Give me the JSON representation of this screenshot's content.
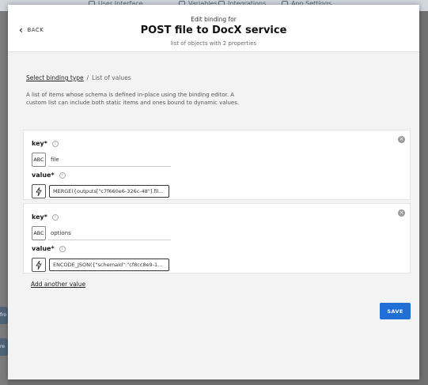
{
  "background": {
    "tabs": [
      {
        "label": "User Interface"
      },
      {
        "label": "Variables"
      },
      {
        "label": "Integrations"
      },
      {
        "label": "App Settings"
      }
    ],
    "left_chips": [
      "fro",
      "re"
    ]
  },
  "header": {
    "back_label": "BACK",
    "pretitle": "Edit binding for",
    "title": "POST file to DocX service",
    "subtitle": "list of objects with 2 properties"
  },
  "breadcrumb": {
    "link": "Select binding type",
    "separator": "/",
    "current": "List of values"
  },
  "description": "A list of items whose schema is defined in-place using the binding editor. A custom list can include both static items and ones bound to dynamic values.",
  "items": [
    {
      "key_label": "key*",
      "key_type": "ABC",
      "key_value": "file",
      "value_label": "value*",
      "value_expression": "MERGE({outputs[\"c7f660e6-326c-48\"].files…"
    },
    {
      "key_label": "key*",
      "key_type": "ABC",
      "key_value": "options",
      "value_label": "value*",
      "value_expression": "ENCODE_JSON({\"schemaId\":\"cf8cc8e9-1…"
    }
  ],
  "add_another_label": "Add another value",
  "save_label": "SAVE",
  "colors": {
    "primary": "#1f6fd6",
    "overlay": "#6f6f6f"
  }
}
